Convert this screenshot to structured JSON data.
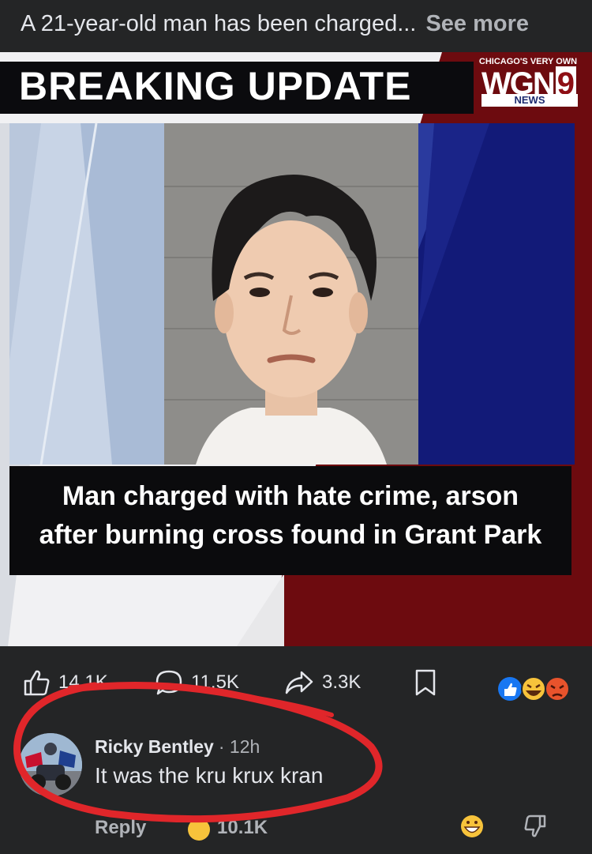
{
  "post": {
    "caption": "A 21-year-old man has been charged...",
    "see_more": "See more"
  },
  "image": {
    "banner": "BREAKING UPDATE",
    "logo_tagline": "CHICAGO'S VERY OWN",
    "logo_wgn": "WGN",
    "logo_nine": "9",
    "logo_news": "NEWS",
    "headline_line1": "Man charged with hate crime, arson",
    "headline_line2": "after burning cross found in Grant Park"
  },
  "actions": {
    "likes": "14.1K",
    "comments": "11.5K",
    "shares": "3.3K"
  },
  "comment": {
    "author": "Ricky Bentley",
    "time": "· 12h",
    "text": "It was the kru krux kran",
    "reply_label": "Reply",
    "reaction_count": "10.1K"
  },
  "colors": {
    "background": "#242526",
    "text": "#e4e6eb",
    "muted": "#b0b3b8",
    "wgn_red": "#8e0f14",
    "annotation_red": "#e0262a"
  },
  "icons": [
    "like-icon",
    "comment-icon",
    "share-icon",
    "bookmark-icon",
    "like-reaction-icon",
    "haha-reaction-icon",
    "angry-reaction-icon",
    "emoji-icon",
    "dislike-icon"
  ]
}
